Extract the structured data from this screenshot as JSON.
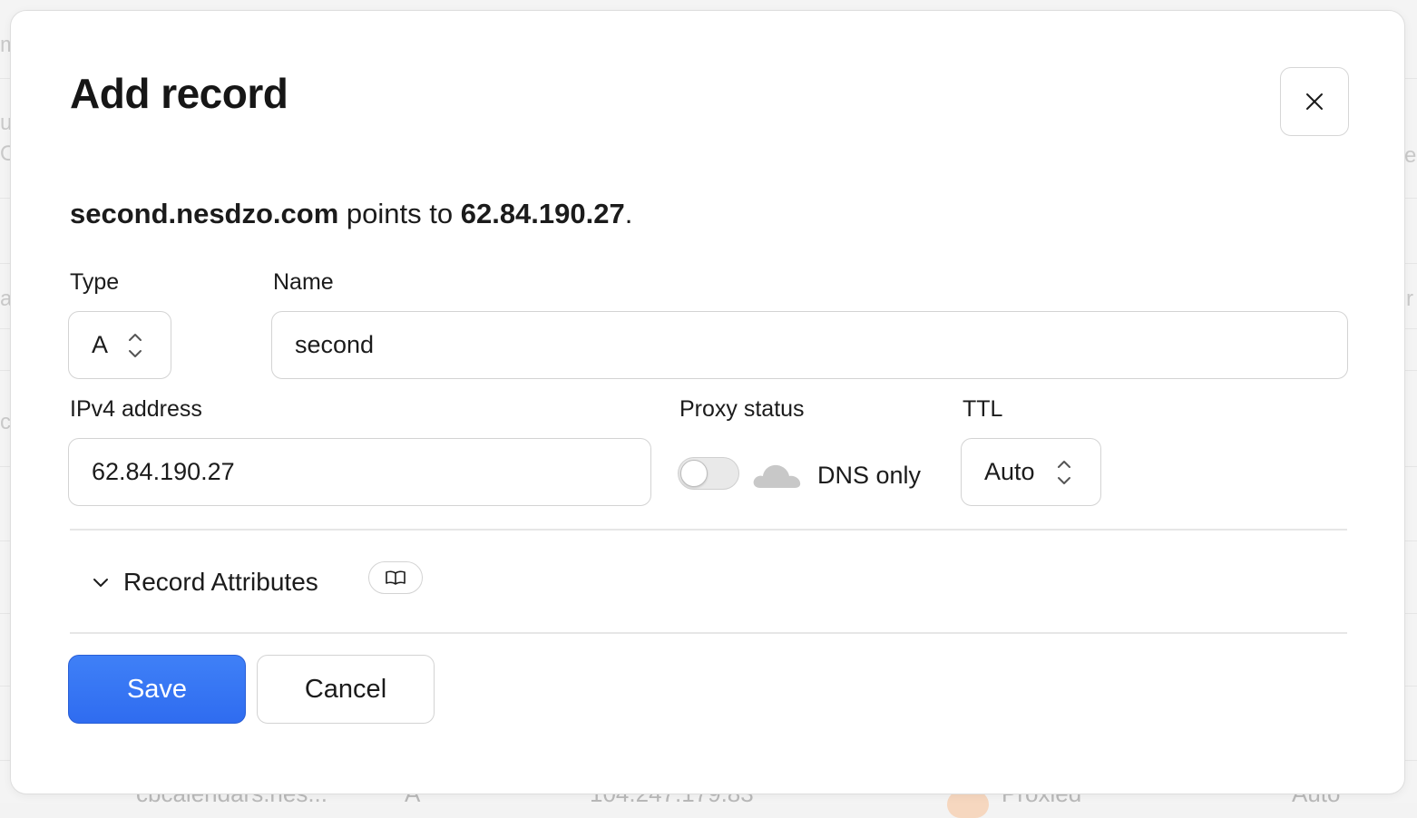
{
  "background": {
    "edge_chars_left": [
      "m",
      "u",
      "O",
      "a",
      "c"
    ],
    "edge_chars_right": [
      "e",
      "r"
    ],
    "bottom_row": {
      "name": "cbcalendars.nes...",
      "type": "A",
      "content": "104.247.179.83",
      "proxy": "Proxied",
      "ttl": "Auto"
    }
  },
  "modal": {
    "title": "Add record",
    "close_icon": "close-icon",
    "summary": {
      "name": "second.nesdzo.com",
      "middle": " points to ",
      "target": "62.84.190.27",
      "end": "."
    },
    "fields": {
      "type": {
        "label": "Type",
        "value": "A"
      },
      "name": {
        "label": "Name",
        "value": "second"
      },
      "ipv4": {
        "label": "IPv4 address",
        "value": "62.84.190.27"
      },
      "proxy": {
        "label": "Proxy status",
        "state_text": "DNS only",
        "enabled": false
      },
      "ttl": {
        "label": "TTL",
        "value": "Auto"
      }
    },
    "attributes": {
      "label": "Record Attributes",
      "expand_icon": "chevron-down-icon",
      "doc_icon": "book-icon"
    },
    "actions": {
      "save": "Save",
      "cancel": "Cancel"
    }
  },
  "colors": {
    "primary": "#3578f5",
    "border": "#d3d3d3",
    "cloud_inactive": "#c8c8c8"
  }
}
